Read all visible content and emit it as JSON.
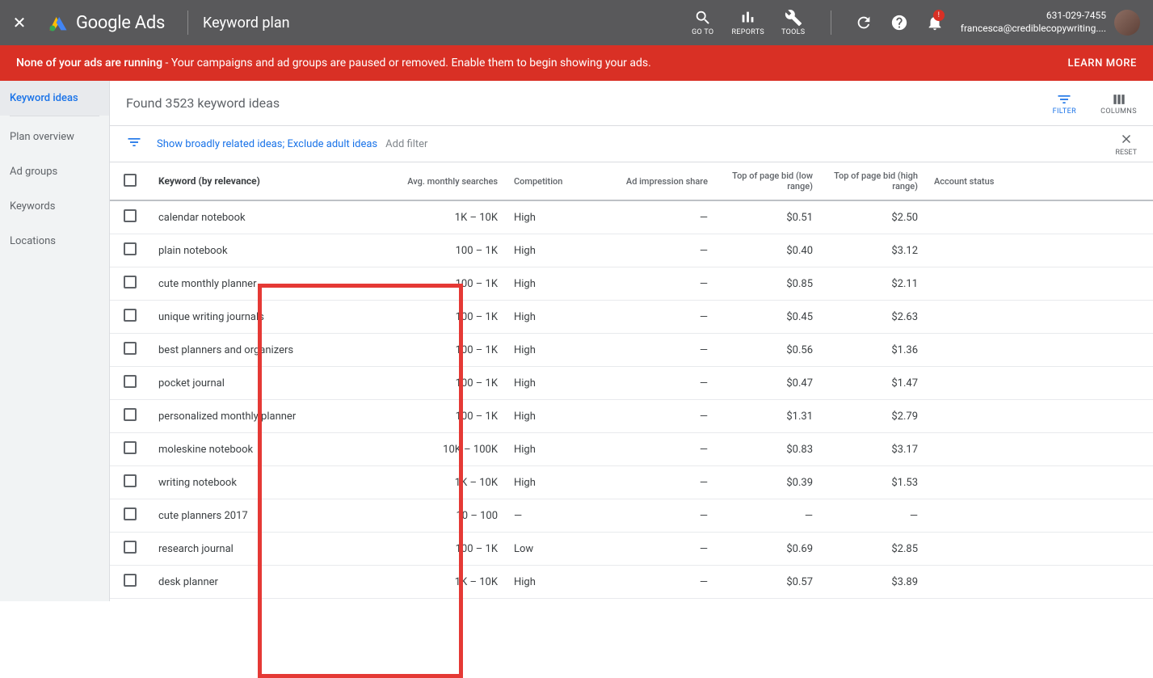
{
  "topbar": {
    "logo_text": "Google Ads",
    "page_title": "Keyword plan",
    "tools": {
      "goto": "GO TO",
      "reports": "REPORTS",
      "tools": "TOOLS"
    },
    "account_phone": "631-029-7455",
    "account_email": "francesca@crediblecopywriting...."
  },
  "alert": {
    "bold": "None of your ads are running",
    "rest": " - Your campaigns and ad groups are paused or removed. Enable them to begin showing your ads.",
    "learn": "LEARN MORE"
  },
  "sidebar": {
    "items": [
      {
        "label": "Keyword ideas",
        "active": true
      },
      {
        "label": "Plan overview"
      },
      {
        "label": "Ad groups"
      },
      {
        "label": "Keywords"
      },
      {
        "label": "Locations"
      }
    ]
  },
  "found_text": "Found 3523 keyword ideas",
  "mini": {
    "filter": "FILTER",
    "columns": "COLUMNS",
    "reset": "RESET"
  },
  "filter_link": "Show broadly related ideas; Exclude adult ideas",
  "filter_add": "Add filter",
  "columns": {
    "keyword": "Keyword (by relevance)",
    "searches": "Avg. monthly searches",
    "competition": "Competition",
    "impression": "Ad impression share",
    "low": "Top of page bid (low range)",
    "high": "Top of page bid (high range)",
    "status": "Account status"
  },
  "rows": [
    {
      "kw": "calendar notebook",
      "srch": "1K – 10K",
      "comp": "High",
      "imp": "—",
      "low": "$0.51",
      "high": "$2.50"
    },
    {
      "kw": "plain notebook",
      "srch": "100 – 1K",
      "comp": "High",
      "imp": "—",
      "low": "$0.40",
      "high": "$3.12"
    },
    {
      "kw": "cute monthly planner",
      "srch": "100 – 1K",
      "comp": "High",
      "imp": "—",
      "low": "$0.85",
      "high": "$2.11"
    },
    {
      "kw": "unique writing journals",
      "srch": "100 – 1K",
      "comp": "High",
      "imp": "—",
      "low": "$0.45",
      "high": "$2.63"
    },
    {
      "kw": "best planners and organizers",
      "srch": "100 – 1K",
      "comp": "High",
      "imp": "—",
      "low": "$0.56",
      "high": "$1.36"
    },
    {
      "kw": "pocket journal",
      "srch": "100 – 1K",
      "comp": "High",
      "imp": "—",
      "low": "$0.47",
      "high": "$1.47"
    },
    {
      "kw": "personalized monthly planner",
      "srch": "100 – 1K",
      "comp": "High",
      "imp": "—",
      "low": "$1.31",
      "high": "$2.79"
    },
    {
      "kw": "moleskine notebook",
      "srch": "10K – 100K",
      "comp": "High",
      "imp": "—",
      "low": "$0.83",
      "high": "$3.17"
    },
    {
      "kw": "writing notebook",
      "srch": "1K – 10K",
      "comp": "High",
      "imp": "—",
      "low": "$0.39",
      "high": "$1.53"
    },
    {
      "kw": "cute planners 2017",
      "srch": "10 – 100",
      "comp": "—",
      "imp": "—",
      "low": "—",
      "high": "—"
    },
    {
      "kw": "research journal",
      "srch": "100 – 1K",
      "comp": "Low",
      "imp": "—",
      "low": "$0.69",
      "high": "$2.85"
    },
    {
      "kw": "desk planner",
      "srch": "1K – 10K",
      "comp": "High",
      "imp": "—",
      "low": "$0.57",
      "high": "$3.89"
    }
  ]
}
